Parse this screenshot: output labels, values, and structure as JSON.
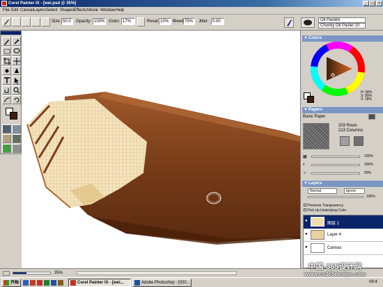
{
  "window": {
    "title": "Corel Painter IX - [wei.psd @ 35%]"
  },
  "menu": {
    "items": [
      "File",
      "Edit",
      "Canvas",
      "Layers",
      "Select",
      "Shapes",
      "Effects",
      "Movie",
      "Window",
      "Help"
    ]
  },
  "property_bar": {
    "size_label": "Size:",
    "size_value": "50.0",
    "opacity_label": "Opacity:",
    "opacity_value": "100%",
    "grain_label": "Grain:",
    "grain_value": "17%",
    "resat_label": "Resat:",
    "resat_value": "10%",
    "bleed_label": "Bleed:",
    "bleed_value": "75%",
    "jitter_label": "Jitter:",
    "jitter_value": "0.00"
  },
  "brush_selector": {
    "category": "Oil Pastels",
    "variant": "Chunky Oil Pastel 10"
  },
  "colors_panel": {
    "title": "Colors",
    "h_label": "H: 38%",
    "s_label": "S: 89%",
    "v_label": "V: 18%",
    "main_color": "#3b1f0c",
    "additional_color": "#ffffff"
  },
  "papers_panel": {
    "title": "Papers",
    "paper_name": "Basic Paper",
    "rows": "203 Rows",
    "columns": "213 Columns",
    "scale_value": "100%",
    "contrast_value": "200%",
    "brightness_value": "50%"
  },
  "layers_panel": {
    "title": "Layers",
    "composite_method": "Normal",
    "composite_depth": "Ignore",
    "opacity_value": "100%",
    "preserve_transparency": "Preserve Transparency",
    "pick_up_color": "Pick Up Underlying Color",
    "layers": [
      {
        "name": "图层 2",
        "selected": true
      },
      {
        "name": "Layer 4",
        "selected": false
      },
      {
        "name": "Canvas",
        "selected": false
      }
    ]
  },
  "statusbar": {
    "zoom": "35%"
  },
  "taskbar": {
    "start_label": "开始",
    "tasks": [
      "Corel Painter IX - [wei...",
      "Adobe Photoshop - [020..."
    ],
    "clock": "09:4"
  },
  "watermark": {
    "line1": "中国-365设计网",
    "line2": "www.cn365design.com"
  },
  "colors": {
    "title_blue": "#0a246a",
    "panel_header": "#7a96c4",
    "wafer": "#f1dcae",
    "chocolate": "#7a3d18"
  }
}
